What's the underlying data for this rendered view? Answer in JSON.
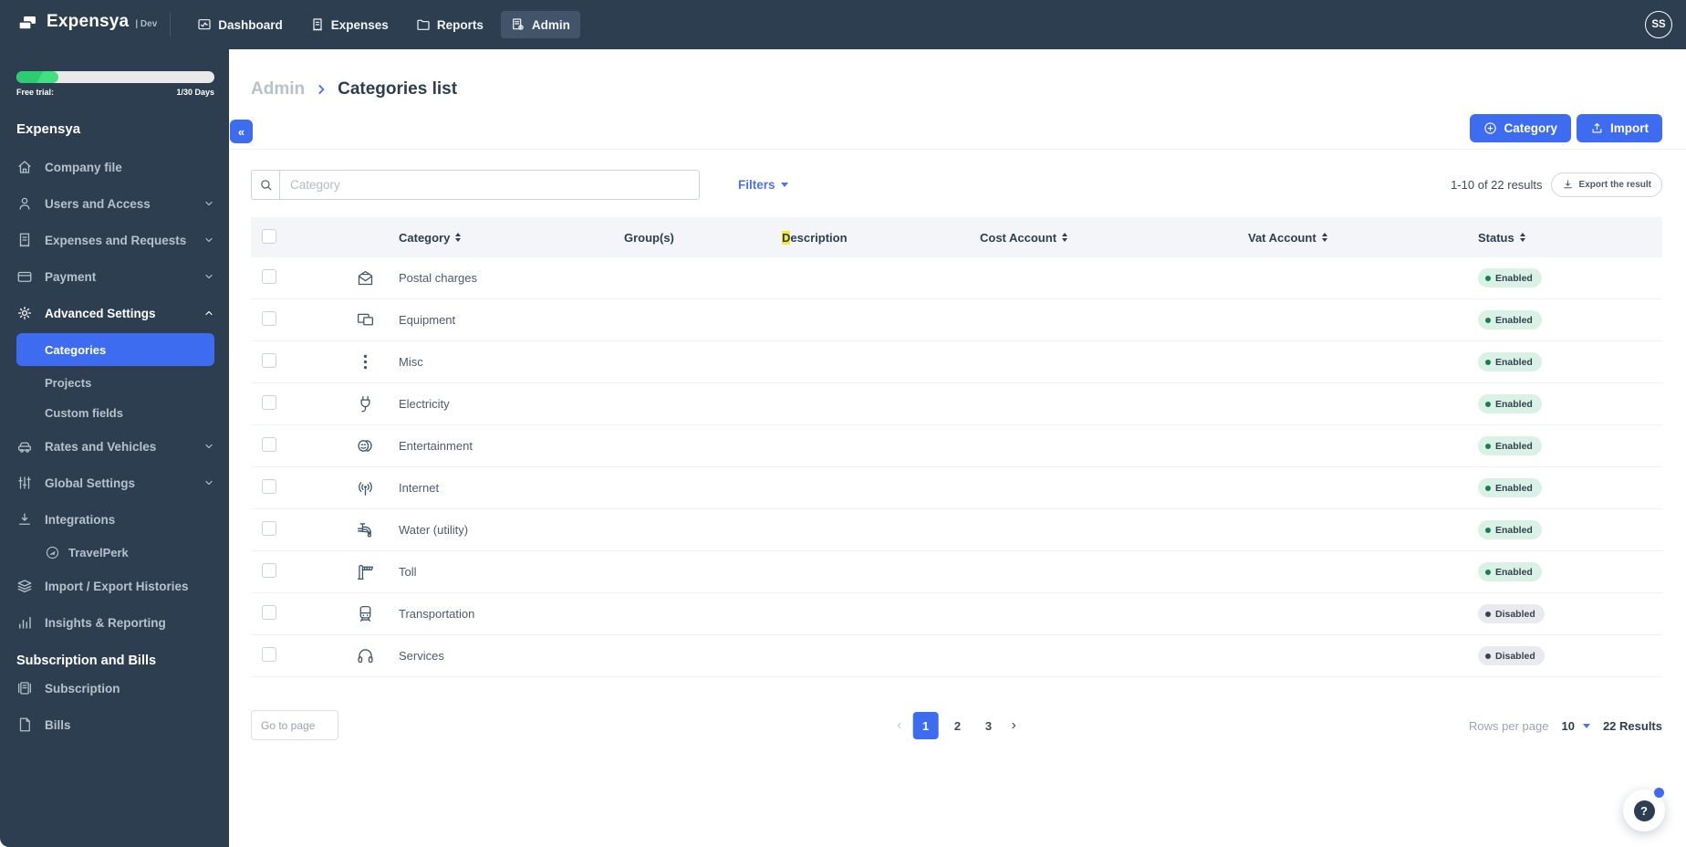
{
  "topbar": {
    "brand": "Expensya",
    "env": "Dev",
    "nav": [
      {
        "label": "Dashboard"
      },
      {
        "label": "Expenses"
      },
      {
        "label": "Reports"
      },
      {
        "label": "Admin"
      }
    ],
    "avatar_initials": "SS"
  },
  "sidebar": {
    "trial_label": "Free trial:",
    "trial_days": "1/30 Days",
    "trial_progress_pct": 21,
    "workspace_title": "Expensya",
    "items": {
      "company_file": "Company file",
      "users_and_access": "Users and Access",
      "expenses_and_requests": "Expenses and Requests",
      "payment": "Payment",
      "advanced_settings": "Advanced Settings",
      "categories": "Categories",
      "projects": "Projects",
      "custom_fields": "Custom fields",
      "rates_and_vehicles": "Rates and Vehicles",
      "global_settings": "Global Settings",
      "integrations": "Integrations",
      "travelperk": "TravelPerk",
      "import_export_histories": "Import / Export Histories",
      "insights_reporting": "Insights & Reporting",
      "subscription": "Subscription",
      "bills": "Bills"
    },
    "section_title": "Subscription and Bills"
  },
  "breadcrumb": {
    "parent": "Admin",
    "current": "Categories list"
  },
  "header_actions": {
    "add_category": "Category",
    "import": "Import"
  },
  "toolbar": {
    "search_placeholder": "Category",
    "filters": "Filters",
    "results_summary": "1-10 of 22 results",
    "export": "Export the result"
  },
  "table": {
    "headers": {
      "category": "Category",
      "groups": "Group(s)",
      "description_highlight": "D",
      "description_rest": "escription",
      "cost_account": "Cost Account",
      "vat_account": "Vat Account",
      "status": "Status"
    },
    "rows": [
      {
        "category": "Postal charges",
        "icon": "envelope-open-icon",
        "status": "Enabled"
      },
      {
        "category": "Equipment",
        "icon": "devices-icon",
        "status": "Enabled"
      },
      {
        "category": "Misc",
        "icon": "kebab-dots-icon",
        "status": "Enabled"
      },
      {
        "category": "Electricity",
        "icon": "plug-icon",
        "status": "Enabled"
      },
      {
        "category": "Entertainment",
        "icon": "theater-masks-icon",
        "status": "Enabled"
      },
      {
        "category": "Internet",
        "icon": "antenna-icon",
        "status": "Enabled"
      },
      {
        "category": "Water (utility)",
        "icon": "faucet-icon",
        "status": "Enabled"
      },
      {
        "category": "Toll",
        "icon": "toll-gate-icon",
        "status": "Enabled"
      },
      {
        "category": "Transportation",
        "icon": "train-icon",
        "status": "Disabled"
      },
      {
        "category": "Services",
        "icon": "headphones-icon",
        "status": "Disabled"
      }
    ]
  },
  "pagination": {
    "goto_placeholder": "Go to page",
    "pages": [
      "1",
      "2",
      "3"
    ],
    "active_page": "1",
    "rows_per_page_label": "Rows per page",
    "rows_per_page_value": "10",
    "total_results": "22 Results"
  },
  "colors": {
    "navy": "#2d3e50",
    "accent_blue": "#3e6cf0",
    "trial_green": "#3ddc7e",
    "enabled_badge_bg": "#d9f2e5",
    "enabled_dot": "#1a7f4f",
    "disabled_badge_bg": "#e8eaf0",
    "highlight_yellow": "#f7e737"
  }
}
